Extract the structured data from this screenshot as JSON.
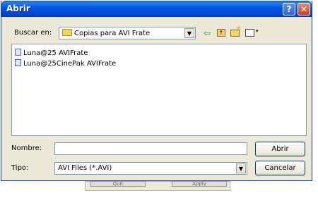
{
  "window": {
    "title": "Abrir",
    "help_label": "?",
    "close_label": "✕"
  },
  "lookin": {
    "label": "Buscar en:",
    "value": "Copias para AVI Frate",
    "arrow": "▼"
  },
  "toolbar": {
    "back_icon": "back-arrow-icon",
    "up_icon": "up-one-level-icon",
    "new_folder_icon": "new-folder-icon",
    "views_icon": "views-menu-icon",
    "back_glyph": "⇦",
    "up_glyph": "↑",
    "star_glyph": "✳",
    "views_arrow": "▾"
  },
  "files": [
    {
      "name": "Luna@25 AVIFrate"
    },
    {
      "name": "Luna@25CinePak AVIFrate"
    }
  ],
  "filename": {
    "label": "Nombre:",
    "value": ""
  },
  "filetype": {
    "label": "Tipo:",
    "value": "AVI Files (*.AVI)",
    "arrow": "▼"
  },
  "buttons": {
    "open": "Abrir",
    "cancel": "Cancelar"
  },
  "background_window": {
    "button1": "Quit",
    "button2": "Apply"
  },
  "colors": {
    "title_bar": "#0054e3",
    "dialog_bg": "#ece9d8",
    "close": "#cc3f1c",
    "field_border": "#7f9db9"
  }
}
